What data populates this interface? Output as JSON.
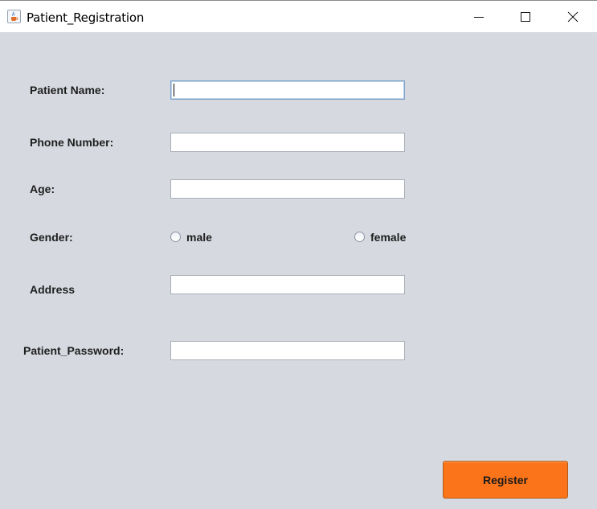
{
  "window": {
    "title": "Patient_Registration",
    "app_icon": "java-cup-icon",
    "controls": [
      "minimize-icon",
      "maximize-icon",
      "close-icon"
    ]
  },
  "form": {
    "patient_name_label": "Patient Name:",
    "patient_name_value": "",
    "phone_label": "Phone Number:",
    "phone_value": "",
    "age_label": "Age:",
    "age_value": "",
    "gender_label": "Gender:",
    "gender_options": [
      "male",
      "female"
    ],
    "gender_selected": null,
    "address_label": "Address",
    "address_value": "",
    "password_label": "Patient_Password:",
    "password_value": ""
  },
  "actions": {
    "register_label": "Register"
  },
  "colors": {
    "background": "#d6d9e0",
    "register_button": "#fc7419",
    "focus_border": "#7ea4c9"
  }
}
